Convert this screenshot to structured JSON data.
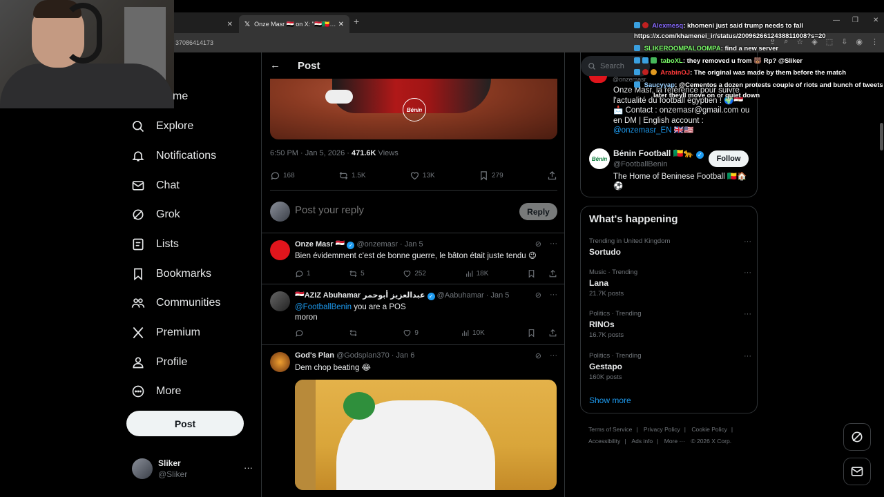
{
  "browser": {
    "tabs": [
      {
        "label": ""
      },
      {
        "label": "Onze Masr 🇪🇬 on X: \"🇪🇬🇧🇯…"
      }
    ],
    "address_fragment": "37086414173"
  },
  "nav": {
    "home_label": "me",
    "items": [
      {
        "label": "Explore",
        "icon": "search-icon"
      },
      {
        "label": "Notifications",
        "icon": "bell-icon"
      },
      {
        "label": "Chat",
        "icon": "mail-icon"
      },
      {
        "label": "Grok",
        "icon": "grok-icon"
      },
      {
        "label": "Lists",
        "icon": "list-icon"
      },
      {
        "label": "Bookmarks",
        "icon": "bookmark-icon"
      },
      {
        "label": "Communities",
        "icon": "communities-icon"
      },
      {
        "label": "Premium",
        "icon": "x-logo-icon"
      },
      {
        "label": "Profile",
        "icon": "person-icon"
      },
      {
        "label": "More",
        "icon": "more-circle-icon"
      }
    ],
    "post_button": "Post",
    "account": {
      "name": "Sliker",
      "handle": "@Sliker",
      "dots": "···"
    }
  },
  "main": {
    "title": "Post",
    "image_logo": "Bénin",
    "meta": {
      "time": "6:50 PM · Jan 5, 2026 · ",
      "views_count": "471.6K",
      "views_label": " Views"
    },
    "actions": {
      "replies": "168",
      "reposts": "1.5K",
      "likes": "13K",
      "bookmarks": "279"
    },
    "reply_placeholder": "Post your reply",
    "reply_button": "Reply",
    "replies": [
      {
        "name": "Onze Masr 🇪🇬",
        "handle": "@onzemasr · Jan 5",
        "text": "Bien évidemment c'est de bonne guerre, le bâton était juste tendu 😉",
        "stats": {
          "replies": "1",
          "reposts": "5",
          "likes": "252",
          "views": "18K"
        }
      },
      {
        "name": "🇪🇬AZIZ Abuhamar عبدالعزيز أبوحمر",
        "handle": "@Aabuhamar · Jan 5",
        "mention": "@FootballBenin",
        "text": " you are a POS",
        "text2": "moron",
        "stats": {
          "replies": "",
          "reposts": "",
          "likes": "9",
          "views": "10K"
        }
      },
      {
        "name": "God's Plan",
        "handle": "@Godsplan370 · Jan 6",
        "text": "Dem chop beating 😂"
      }
    ]
  },
  "right": {
    "search_placeholder": "Search",
    "bio_cut": "@onzemasr",
    "bio": "Onze Masr, la référence pour suivre l'actualité du football égyptien ! 🌍🇪🇬 📩 Contact : onzemasr@gmail.com ou en DM | English account : ",
    "bio_mention": "@onzemasr_EN 🇬🇧🇺🇸",
    "profile": {
      "avatar_text": "Bénin",
      "name": "Bénin Football 🇧🇯🐆",
      "handle": "@FootballBenin",
      "desc": "The Home of Beninese Football 🇧🇯🏠⚽",
      "follow": "Follow"
    },
    "whats_happening": "What's happening",
    "trends": [
      {
        "cat": "Trending in United Kingdom",
        "name": "Sortudo",
        "count": ""
      },
      {
        "cat": "Music · Trending",
        "name": "Lana",
        "count": "21.7K posts"
      },
      {
        "cat": "Politics · Trending",
        "name": "RINOs",
        "count": "16.7K posts"
      },
      {
        "cat": "Politics · Trending",
        "name": "Gestapo",
        "count": "160K posts"
      }
    ],
    "show_more": "Show more",
    "footer": [
      "Terms of Service",
      "|",
      "Privacy Policy",
      "|",
      "Cookie Policy",
      "|",
      "Accessibility",
      "|",
      "Ads info",
      "|",
      "More ···",
      "© 2026 X Corp."
    ]
  },
  "chat": [
    {
      "user": "Alexmesq",
      "color": "#8a6cff",
      "msg": ": khomeni just said trump needs to fall"
    },
    {
      "user": "",
      "color": "#ffffff",
      "msg": "https://x.com/khamenei_ir/status/2009626612438811008?s=20"
    },
    {
      "user": "SLIKEROOMPALOOMPA",
      "color": "#7cff6a",
      "msg": ": find a new server"
    },
    {
      "user": "taboXL",
      "color": "#7cff6a",
      "msg": ": they removed u from 🐻 Rp? @Sliker"
    },
    {
      "user": "ArabinOJ",
      "color": "#ff3a3a",
      "msg": ": The original was made by them before the match"
    },
    {
      "user": "Saucyyap",
      "color": "#9ad0ff",
      "msg": ": @Cementos a dozen protests couple of riots and bunch of tweets"
    },
    {
      "user": "",
      "color": "#ffffff",
      "msg": "later theyll move on or quiet down"
    }
  ],
  "colors": {
    "accent": "#1d9bf0",
    "bg": "#000000",
    "border": "#2f3336",
    "muted": "#71767b"
  }
}
